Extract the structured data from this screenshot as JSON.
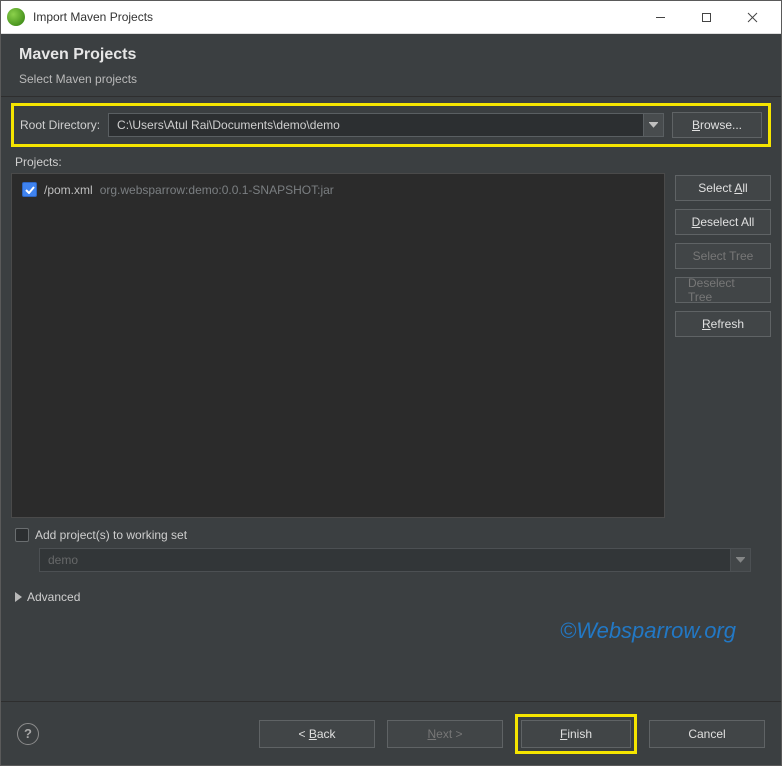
{
  "window": {
    "title": "Import Maven Projects"
  },
  "header": {
    "title": "Maven Projects",
    "subtitle": "Select Maven projects"
  },
  "root": {
    "label": "Root Directory:",
    "path": "C:\\Users\\Atul Rai\\Documents\\demo\\demo",
    "browse_prefix": "B",
    "browse_rest": "rowse..."
  },
  "projects": {
    "label": "Projects:",
    "items": [
      {
        "name": "/pom.xml",
        "coords": "org.websparrow:demo:0.0.1-SNAPSHOT:jar",
        "checked": true
      }
    ]
  },
  "sidebuttons": {
    "selectAll_pre": "Select ",
    "selectAll_u": "A",
    "selectAll_post": "ll",
    "deselectAll_u": "D",
    "deselectAll_post": "eselect All",
    "selectTree": "Select Tree",
    "deselectTree": "Deselect Tree",
    "refresh_u": "R",
    "refresh_post": "efresh"
  },
  "workset": {
    "addLabel": "Add project(s) to working set",
    "comboValue": "demo"
  },
  "advanced": {
    "label": "Advanced"
  },
  "watermark": "©Websparrow.org",
  "footer": {
    "back_pre": "< ",
    "back_u": "B",
    "back_post": "ack",
    "next_u": "N",
    "next_post": "ext >",
    "finish_u": "F",
    "finish_post": "inish",
    "cancel": "Cancel"
  }
}
